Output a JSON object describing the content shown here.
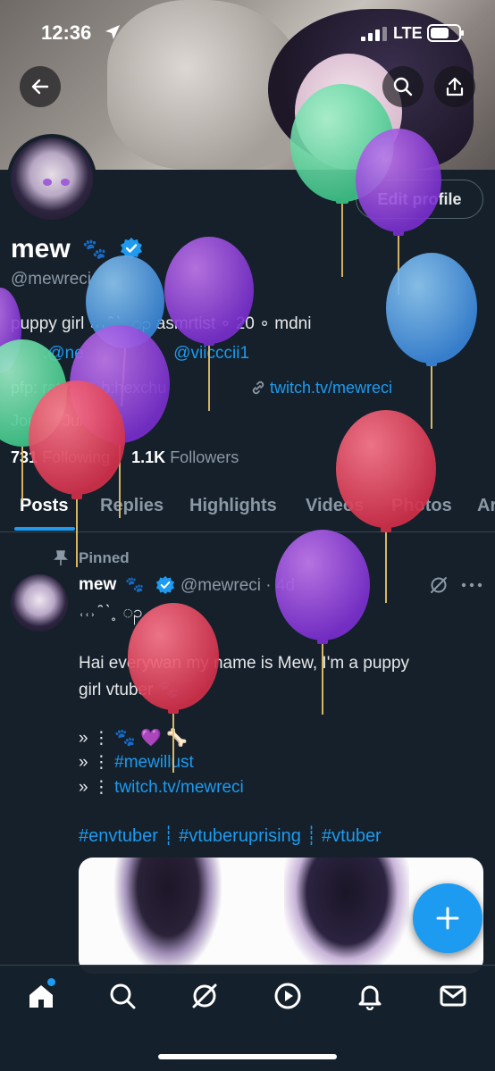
{
  "status_bar": {
    "time": "12:36",
    "network": "LTE"
  },
  "profile": {
    "edit_button": "Edit profile",
    "name": "mew",
    "name_emoji": "🐾",
    "handle": "@mewreci",
    "bio_line1": "puppy girl ˓˓˒ ̑ ˋ˳ ၣ asmrtist ∘ 20 ∘ mdni",
    "bio_line2_links": ":@ne",
    "bio_line2_link2": "@viicccii1",
    "location": "pfp:  ratyan♡b:hexchu",
    "website": "twitch.tv/mewreci",
    "joined": "Joined Jul 2023",
    "following_count": "731",
    "following_label": "Following",
    "followers_count": "1.1K",
    "followers_label": "Followers"
  },
  "tabs": [
    "Posts",
    "Replies",
    "Highlights",
    "Videos",
    "Photos",
    "Ar"
  ],
  "post": {
    "pinned_label": "Pinned",
    "author": "mew",
    "author_emoji": "🐾",
    "handle_time": "@mewreci · 4d",
    "line1": "˓˓˒ ̑ ˋ˳ ၣ",
    "line2": "Hai everywan my name is Mew, I'm a puppy",
    "line3": "girl vtuber 🐾",
    "line4": "» ⋮ 🐾 💜 🦴",
    "line5_prefix": "» ⋮ ",
    "line5_link": "#mewillust",
    "line6_prefix": "» ⋮ ",
    "line6_link": "twitch.tv/mewreci",
    "hashtags": "#envtuber ┊ #vtuberuprising ┊ #vtuber"
  },
  "nav": {
    "items": [
      "home-icon",
      "search-icon",
      "grok-icon",
      "spaces-icon",
      "notifications-icon",
      "messages-icon"
    ]
  },
  "colors": {
    "accent": "#1d9bf0",
    "background": "#15202b",
    "muted": "#8b98a5",
    "divider": "#38444d"
  }
}
